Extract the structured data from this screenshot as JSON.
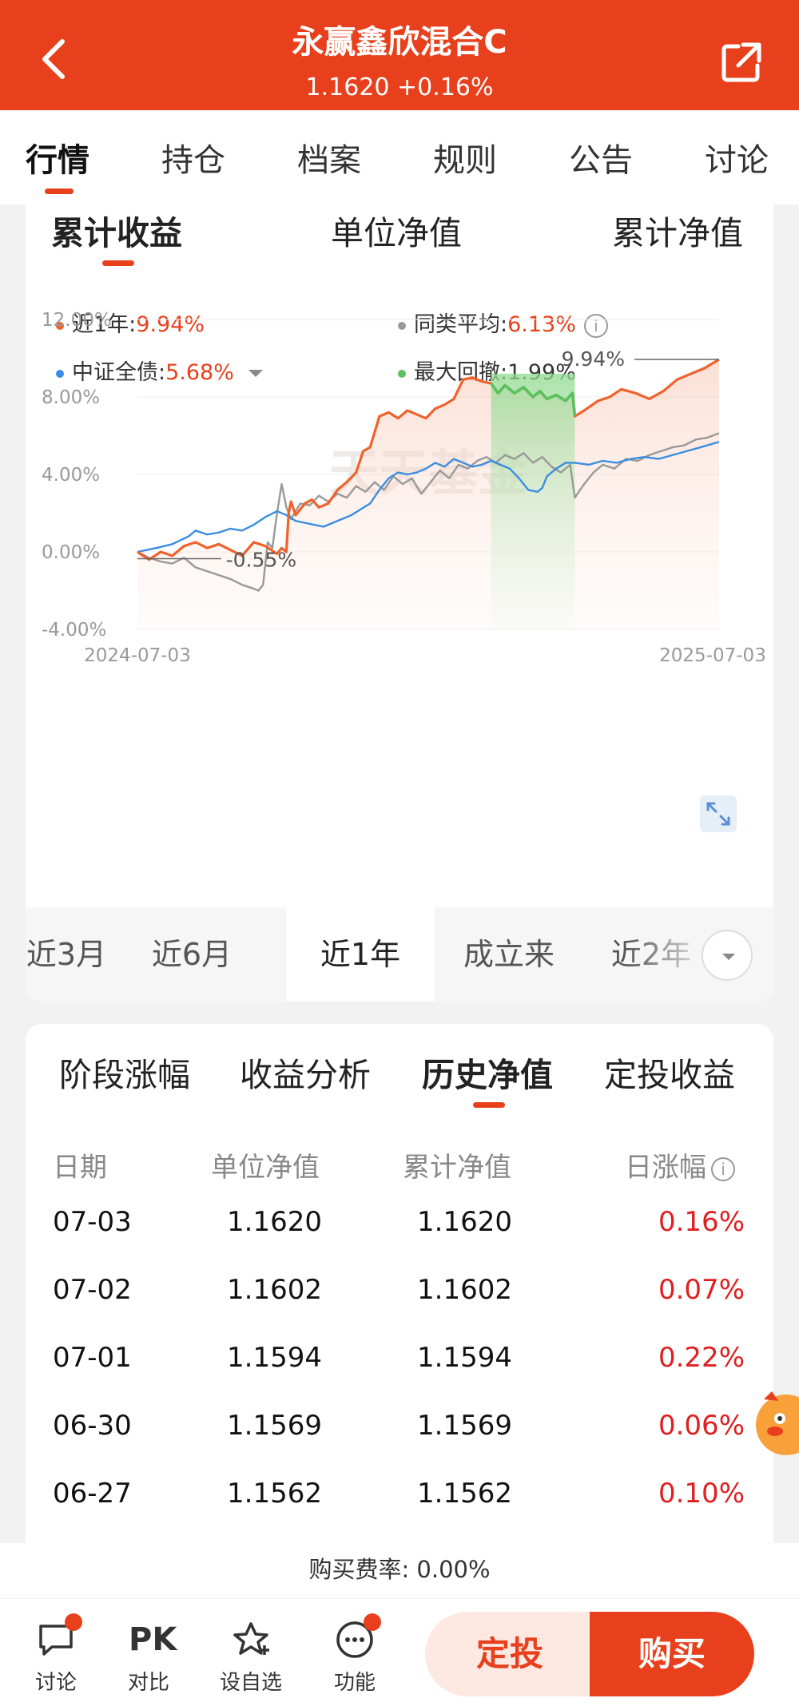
{
  "header": {
    "title": "永赢鑫欣混合C",
    "subtitle": "1.1620 +0.16%"
  },
  "top_tabs": [
    "行情",
    "持仓",
    "档案",
    "规则",
    "公告",
    "讨论"
  ],
  "chart_tabs": [
    "累计收益",
    "单位净值",
    "累计净值"
  ],
  "legend": {
    "fund_label": "近1年:",
    "fund_value": "9.94%",
    "peer_label": "同类平均:",
    "peer_value": "6.13%",
    "bench_label": "中证全债:",
    "bench_value": "5.68%",
    "dd_label": "最大回撤:",
    "dd_value": "1.99%"
  },
  "chart_annotations": {
    "end_label": "9.94%",
    "min_label": "-0.55%",
    "watermark": "天天基金"
  },
  "colors": {
    "brand": "#e8401c",
    "fund": "#f0622b",
    "peer": "#999999",
    "benchmark": "#3a8de0",
    "drawdown": "#5cc05c",
    "down_text": "#e02020"
  },
  "chart_data": {
    "type": "line",
    "ylabel": "",
    "xlabel": "",
    "yticks": [
      "12.00%",
      "8.00%",
      "4.00%",
      "0.00%",
      "-4.00%"
    ],
    "ylim": [
      -4,
      12
    ],
    "x_start_label": "2024-07-03",
    "x_end_label": "2025-07-03",
    "x_range": [
      0,
      250
    ],
    "grid": true,
    "max_drawdown_span": [
      152,
      188
    ],
    "series": [
      {
        "name": "近1年",
        "color": "#f0622b",
        "fill": true,
        "points": [
          [
            0,
            0
          ],
          [
            5,
            -0.4
          ],
          [
            10,
            0
          ],
          [
            15,
            -0.2
          ],
          [
            20,
            0.3
          ],
          [
            25,
            0.5
          ],
          [
            30,
            0.2
          ],
          [
            35,
            0.4
          ],
          [
            40,
            0.1
          ],
          [
            45,
            -0.2
          ],
          [
            50,
            0.5
          ],
          [
            55,
            0.3
          ],
          [
            60,
            -0.1
          ],
          [
            62,
            0.2
          ],
          [
            64,
            0.0
          ],
          [
            65,
            2.0
          ],
          [
            66,
            2.6
          ],
          [
            68,
            1.9
          ],
          [
            70,
            2.2
          ],
          [
            72,
            2.5
          ],
          [
            75,
            2.7
          ],
          [
            78,
            2.3
          ],
          [
            82,
            2.5
          ],
          [
            86,
            3.2
          ],
          [
            90,
            3.6
          ],
          [
            94,
            4.1
          ],
          [
            97,
            5.2
          ],
          [
            100,
            5.4
          ],
          [
            104,
            7.0
          ],
          [
            108,
            7.2
          ],
          [
            112,
            6.9
          ],
          [
            116,
            7.3
          ],
          [
            120,
            7.1
          ],
          [
            124,
            6.9
          ],
          [
            128,
            7.4
          ],
          [
            132,
            7.6
          ],
          [
            136,
            7.9
          ],
          [
            140,
            8.9
          ],
          [
            144,
            9.0
          ],
          [
            148,
            8.8
          ],
          [
            152,
            8.7
          ],
          [
            155,
            8.2
          ],
          [
            158,
            8.6
          ],
          [
            162,
            8.2
          ],
          [
            166,
            8.5
          ],
          [
            170,
            8.0
          ],
          [
            173,
            8.3
          ],
          [
            176,
            7.9
          ],
          [
            180,
            8.1
          ],
          [
            184,
            7.8
          ],
          [
            187,
            8.2
          ],
          [
            188,
            7.0
          ],
          [
            192,
            7.3
          ],
          [
            198,
            7.8
          ],
          [
            203,
            8.0
          ],
          [
            208,
            8.4
          ],
          [
            214,
            8.2
          ],
          [
            220,
            7.9
          ],
          [
            226,
            8.3
          ],
          [
            232,
            8.9
          ],
          [
            238,
            9.2
          ],
          [
            244,
            9.5
          ],
          [
            250,
            9.94
          ]
        ]
      },
      {
        "name": "同类平均",
        "color": "#999999",
        "fill": false,
        "points": [
          [
            0,
            0
          ],
          [
            5,
            -0.3
          ],
          [
            10,
            -0.5
          ],
          [
            15,
            -0.6
          ],
          [
            20,
            -0.3
          ],
          [
            25,
            -0.8
          ],
          [
            30,
            -1.0
          ],
          [
            35,
            -1.2
          ],
          [
            40,
            -1.4
          ],
          [
            45,
            -1.7
          ],
          [
            50,
            -1.9
          ],
          [
            52,
            -2.0
          ],
          [
            54,
            -1.7
          ],
          [
            56,
            0.5
          ],
          [
            58,
            0.2
          ],
          [
            60,
            2.0
          ],
          [
            62,
            3.5
          ],
          [
            64,
            2.3
          ],
          [
            66,
            1.7
          ],
          [
            70,
            2.5
          ],
          [
            74,
            2.4
          ],
          [
            78,
            2.9
          ],
          [
            82,
            2.6
          ],
          [
            86,
            3.0
          ],
          [
            90,
            2.8
          ],
          [
            94,
            3.4
          ],
          [
            98,
            3.1
          ],
          [
            102,
            3.6
          ],
          [
            106,
            3.2
          ],
          [
            110,
            3.9
          ],
          [
            114,
            3.5
          ],
          [
            118,
            3.8
          ],
          [
            122,
            3.0
          ],
          [
            126,
            3.6
          ],
          [
            130,
            4.2
          ],
          [
            134,
            3.8
          ],
          [
            138,
            4.5
          ],
          [
            142,
            4.3
          ],
          [
            146,
            4.7
          ],
          [
            150,
            4.9
          ],
          [
            154,
            4.6
          ],
          [
            158,
            5.0
          ],
          [
            162,
            4.8
          ],
          [
            166,
            5.1
          ],
          [
            170,
            4.6
          ],
          [
            174,
            4.9
          ],
          [
            178,
            4.4
          ],
          [
            182,
            4.1
          ],
          [
            186,
            4.5
          ],
          [
            188,
            2.8
          ],
          [
            192,
            3.5
          ],
          [
            196,
            4.1
          ],
          [
            200,
            4.5
          ],
          [
            205,
            4.3
          ],
          [
            210,
            4.8
          ],
          [
            215,
            4.7
          ],
          [
            220,
            5.0
          ],
          [
            225,
            5.2
          ],
          [
            230,
            5.4
          ],
          [
            235,
            5.5
          ],
          [
            240,
            5.8
          ],
          [
            245,
            5.9
          ],
          [
            250,
            6.13
          ]
        ]
      },
      {
        "name": "中证全债",
        "color": "#3a8de0",
        "fill": false,
        "points": [
          [
            0,
            0
          ],
          [
            8,
            0.2
          ],
          [
            15,
            0.4
          ],
          [
            22,
            0.8
          ],
          [
            25,
            1.1
          ],
          [
            30,
            0.9
          ],
          [
            35,
            1.0
          ],
          [
            40,
            1.2
          ],
          [
            45,
            1.1
          ],
          [
            50,
            1.4
          ],
          [
            55,
            1.8
          ],
          [
            60,
            2.1
          ],
          [
            64,
            1.9
          ],
          [
            68,
            1.6
          ],
          [
            72,
            1.5
          ],
          [
            76,
            1.4
          ],
          [
            80,
            1.3
          ],
          [
            84,
            1.5
          ],
          [
            88,
            1.7
          ],
          [
            92,
            1.9
          ],
          [
            96,
            2.2
          ],
          [
            100,
            2.5
          ],
          [
            104,
            3.2
          ],
          [
            108,
            3.8
          ],
          [
            112,
            4.1
          ],
          [
            116,
            4.0
          ],
          [
            120,
            4.1
          ],
          [
            124,
            4.3
          ],
          [
            128,
            4.6
          ],
          [
            132,
            4.4
          ],
          [
            136,
            4.8
          ],
          [
            140,
            4.6
          ],
          [
            144,
            4.4
          ],
          [
            148,
            4.5
          ],
          [
            152,
            4.7
          ],
          [
            156,
            4.5
          ],
          [
            160,
            4.3
          ],
          [
            164,
            3.8
          ],
          [
            168,
            3.2
          ],
          [
            172,
            3.1
          ],
          [
            174,
            3.3
          ],
          [
            176,
            3.9
          ],
          [
            180,
            4.3
          ],
          [
            184,
            4.6
          ],
          [
            188,
            4.6
          ],
          [
            194,
            4.5
          ],
          [
            200,
            4.7
          ],
          [
            206,
            4.6
          ],
          [
            212,
            4.8
          ],
          [
            218,
            4.9
          ],
          [
            224,
            4.8
          ],
          [
            230,
            5.0
          ],
          [
            236,
            5.2
          ],
          [
            242,
            5.4
          ],
          [
            250,
            5.68
          ]
        ]
      }
    ]
  },
  "range_tabs": [
    "近3月",
    "近6月",
    "近1年",
    "成立来",
    "近2年"
  ],
  "history_tabs": [
    "阶段涨幅",
    "收益分析",
    "历史净值",
    "定投收益"
  ],
  "history_headers": [
    "日期",
    "单位净值",
    "累计净值",
    "日涨幅"
  ],
  "history_rows": [
    {
      "date": "07-03",
      "unit": "1.1620",
      "accum": "1.1620",
      "change": "0.16%"
    },
    {
      "date": "07-02",
      "unit": "1.1602",
      "accum": "1.1602",
      "change": "0.07%"
    },
    {
      "date": "07-01",
      "unit": "1.1594",
      "accum": "1.1594",
      "change": "0.22%"
    },
    {
      "date": "06-30",
      "unit": "1.1569",
      "accum": "1.1569",
      "change": "0.06%"
    },
    {
      "date": "06-27",
      "unit": "1.1562",
      "accum": "1.1562",
      "change": "0.10%"
    }
  ],
  "fee_text": "购买费率: 0.00%",
  "bottom_nav": [
    {
      "label": "讨论",
      "icon": "chat-bubble-icon"
    },
    {
      "label": "对比",
      "icon": "pk-icon",
      "icon_text": "PK"
    },
    {
      "label": "设自选",
      "icon": "star-plus-icon"
    },
    {
      "label": "功能",
      "icon": "more-dots-icon"
    }
  ],
  "buttons": {
    "dingtou": "定投",
    "buy": "购买"
  }
}
